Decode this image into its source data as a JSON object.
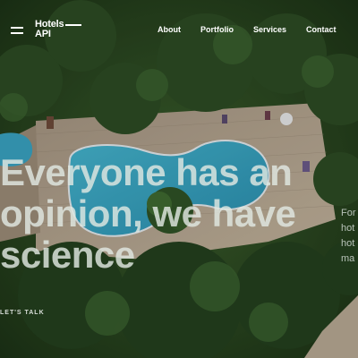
{
  "brand": {
    "line1": "Hotels",
    "line2": "API"
  },
  "nav": {
    "items": [
      {
        "label": "About"
      },
      {
        "label": "Portfolio"
      },
      {
        "label": "Services"
      },
      {
        "label": "Contact"
      }
    ]
  },
  "hero": {
    "headline_lines": [
      "Everyone has an",
      "opinion, we have",
      "science"
    ],
    "side_text_lines": [
      "For",
      "hot",
      "hot",
      "ma"
    ],
    "cta_label": "LET'S TALK"
  },
  "colors": {
    "foliage": "#2a4a22",
    "deck": "#b8a891",
    "pool": "#3aa8c4",
    "text": "#ffffff"
  },
  "icons": {
    "menu": "hamburger-icon"
  }
}
